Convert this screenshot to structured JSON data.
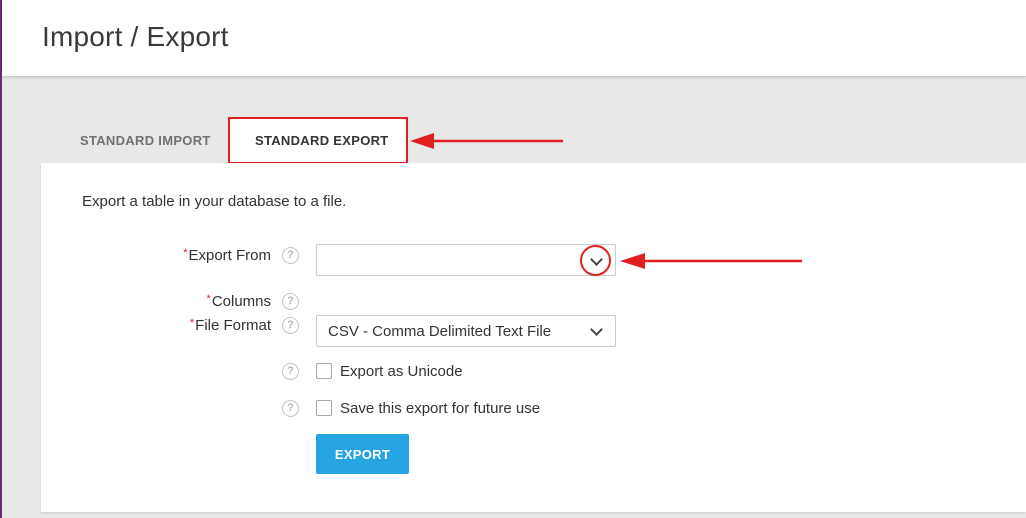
{
  "header": {
    "title": "Import / Export"
  },
  "tabs": [
    {
      "label": "STANDARD IMPORT",
      "active": false
    },
    {
      "label": "STANDARD EXPORT",
      "active": true
    }
  ],
  "panel": {
    "intro": "Export a table in your database to a file.",
    "fields": {
      "export_from": {
        "required_mark": "*",
        "label": "Export From",
        "value": ""
      },
      "columns": {
        "required_mark": "*",
        "label": "Columns"
      },
      "file_format": {
        "required_mark": "*",
        "label": "File Format",
        "value": "CSV - Comma Delimited Text File"
      }
    },
    "options": {
      "unicode": {
        "label": "Export as Unicode",
        "checked": false
      },
      "save": {
        "label": "Save this export for future use",
        "checked": false
      }
    },
    "export_button": "EXPORT",
    "help_glyph": "?"
  },
  "colors": {
    "accent": "#27a5e3",
    "annotation": "#e02020",
    "sidebar_edge": "#6a2c70"
  },
  "icons": {
    "help": "question-circle-icon",
    "dropdown": "chevron-down-icon"
  }
}
